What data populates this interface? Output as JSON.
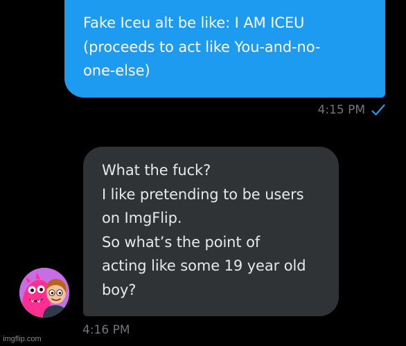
{
  "conversation": {
    "sent_message": {
      "lines": [
        "Fake Iceu alt be like: I AM ICEU",
        "(proceeds to act like You-and-no-",
        "one-else)"
      ],
      "time": "4:15 PM",
      "status_icon": "read-check-icon"
    },
    "received_message": {
      "lines": [
        "What the fuck?",
        "I like pretending to be users",
        "on ImgFlip.",
        "So what’s the point of",
        "acting like some 19 year old",
        "boy?"
      ],
      "time": "4:16 PM"
    },
    "avatar": {
      "icon": "cartoon-avatar-icon"
    }
  },
  "watermark": "imgflip.com",
  "colors": {
    "background": "#000000",
    "sent_bubble": "#1d9bf0",
    "received_bubble": "#2f3336",
    "timestamp": "#71767b"
  }
}
